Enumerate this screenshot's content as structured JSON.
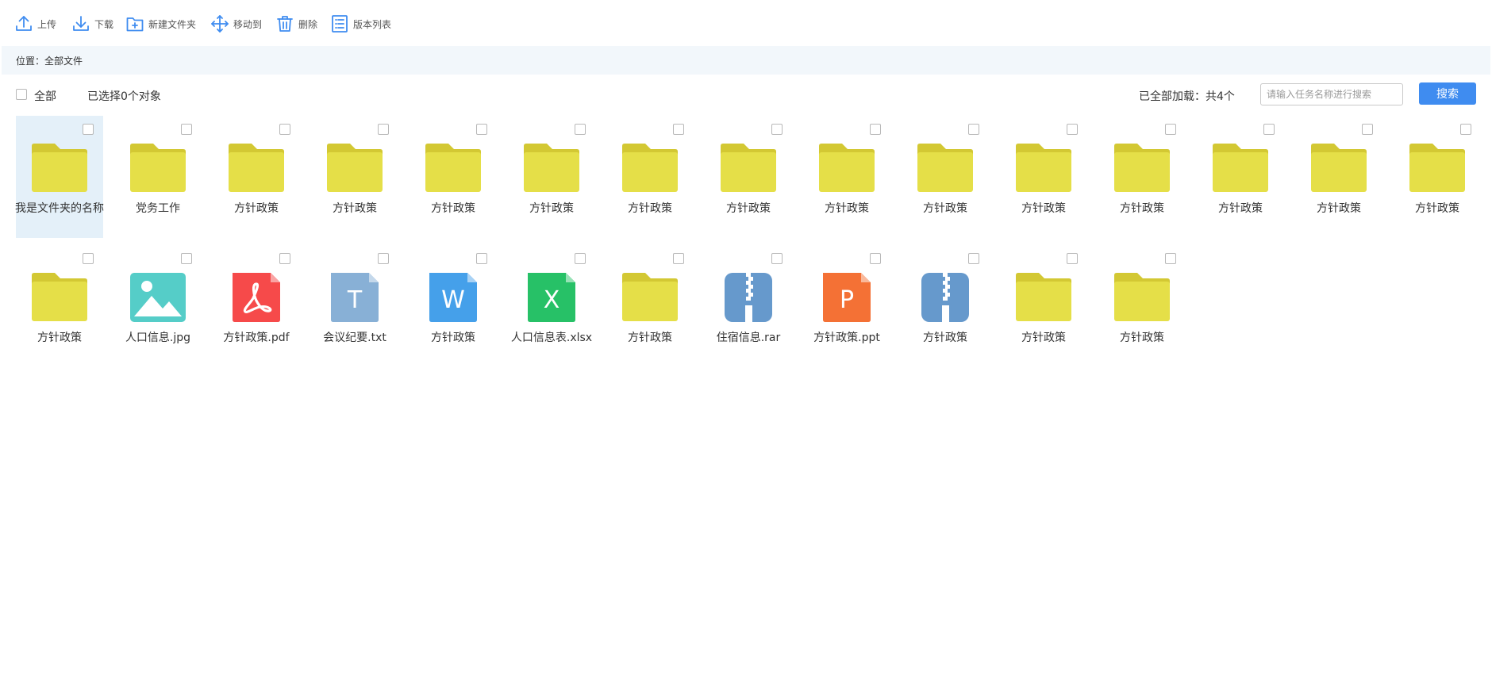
{
  "toolbar": {
    "upload": "上传",
    "download": "下载",
    "new_folder": "新建文件夹",
    "move_to": "移动到",
    "delete": "删除",
    "version_list": "版本列表"
  },
  "location": {
    "text": "位置：全部文件"
  },
  "selection": {
    "select_all_label": "全部",
    "selected_text": "已选择0个对象",
    "loaded_text": "已全部加载：共4个"
  },
  "search": {
    "placeholder": "请输入任务名称进行搜索",
    "button": "搜索"
  },
  "colors": {
    "accent": "#3f8cf0",
    "folder": "#e5df48",
    "selected_bg": "#e4f0f9"
  },
  "files": {
    "row1": [
      {
        "name": "我是文件夹的名称",
        "type": "folder",
        "selected": true
      },
      {
        "name": "党务工作",
        "type": "folder"
      },
      {
        "name": "方针政策",
        "type": "folder"
      },
      {
        "name": "方针政策",
        "type": "folder"
      },
      {
        "name": "方针政策",
        "type": "folder"
      },
      {
        "name": "方针政策",
        "type": "folder"
      },
      {
        "name": "方针政策",
        "type": "folder"
      },
      {
        "name": "方针政策",
        "type": "folder"
      },
      {
        "name": "方针政策",
        "type": "folder"
      },
      {
        "name": "方针政策",
        "type": "folder"
      },
      {
        "name": "方针政策",
        "type": "folder"
      },
      {
        "name": "方针政策",
        "type": "folder"
      },
      {
        "name": "方针政策",
        "type": "folder"
      },
      {
        "name": "方针政策",
        "type": "folder"
      },
      {
        "name": "方针政策",
        "type": "folder"
      }
    ],
    "row2": [
      {
        "name": "方针政策",
        "type": "folder"
      },
      {
        "name": "人口信息.jpg",
        "type": "image"
      },
      {
        "name": "方针政策.pdf",
        "type": "pdf"
      },
      {
        "name": "会议纪要.txt",
        "type": "txt",
        "letter": "T"
      },
      {
        "name": "方针政策",
        "type": "word",
        "letter": "W"
      },
      {
        "name": "人口信息表.xlsx",
        "type": "excel",
        "letter": "X"
      },
      {
        "name": "方针政策",
        "type": "folder"
      },
      {
        "name": "住宿信息.rar",
        "type": "zip"
      },
      {
        "name": "方针政策.ppt",
        "type": "ppt",
        "letter": "P"
      },
      {
        "name": "方针政策",
        "type": "zip"
      },
      {
        "name": "方针政策",
        "type": "folder"
      },
      {
        "name": "方针政策",
        "type": "folder"
      }
    ]
  }
}
